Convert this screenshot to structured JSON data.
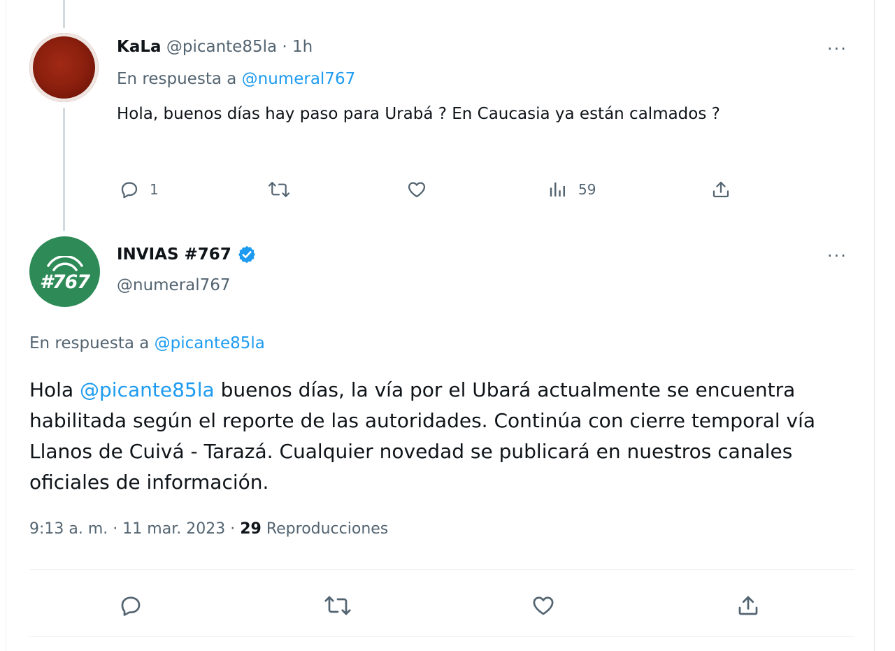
{
  "reply_tweet": {
    "name": "KaLa",
    "handle": "@picante85la",
    "dot": "·",
    "time": "1h",
    "reply_prefix": "En respuesta a",
    "reply_handle": "@numeral767",
    "text": "Hola, buenos días hay paso para Urabá ? En Caucasia ya están calmados ?",
    "more": "···",
    "actions": {
      "reply_count": "1",
      "views_count": "59"
    }
  },
  "main_tweet": {
    "name": "INVIAS #767",
    "avatar_text": "#767",
    "handle": "@numeral767",
    "more": "···",
    "reply_prefix": "En respuesta a",
    "reply_handle": "@picante85la",
    "text_greeting": "Hola",
    "text_mention": "@picante85la",
    "text_rest": "buenos días, la vía por el Ubará actualmente se encuentra habilitada según el reporte de las autoridades. Continúa con cierre temporal vía Llanos de Cuivá - Tarazá. Cualquier novedad se publicará en nuestros canales oficiales de información.",
    "time": "9:13 a. m.",
    "date": "11 mar. 2023",
    "sep": "·",
    "views_number": "29",
    "views_label": "Reproducciones"
  },
  "colors": {
    "link": "#1d9bf0",
    "muted": "#536471",
    "verified": "#1d9bf0",
    "invias_green": "#2e8b57"
  },
  "icons": [
    "reply-icon",
    "retweet-icon",
    "like-icon",
    "views-icon",
    "share-icon",
    "verified-badge-icon",
    "more-icon"
  ]
}
